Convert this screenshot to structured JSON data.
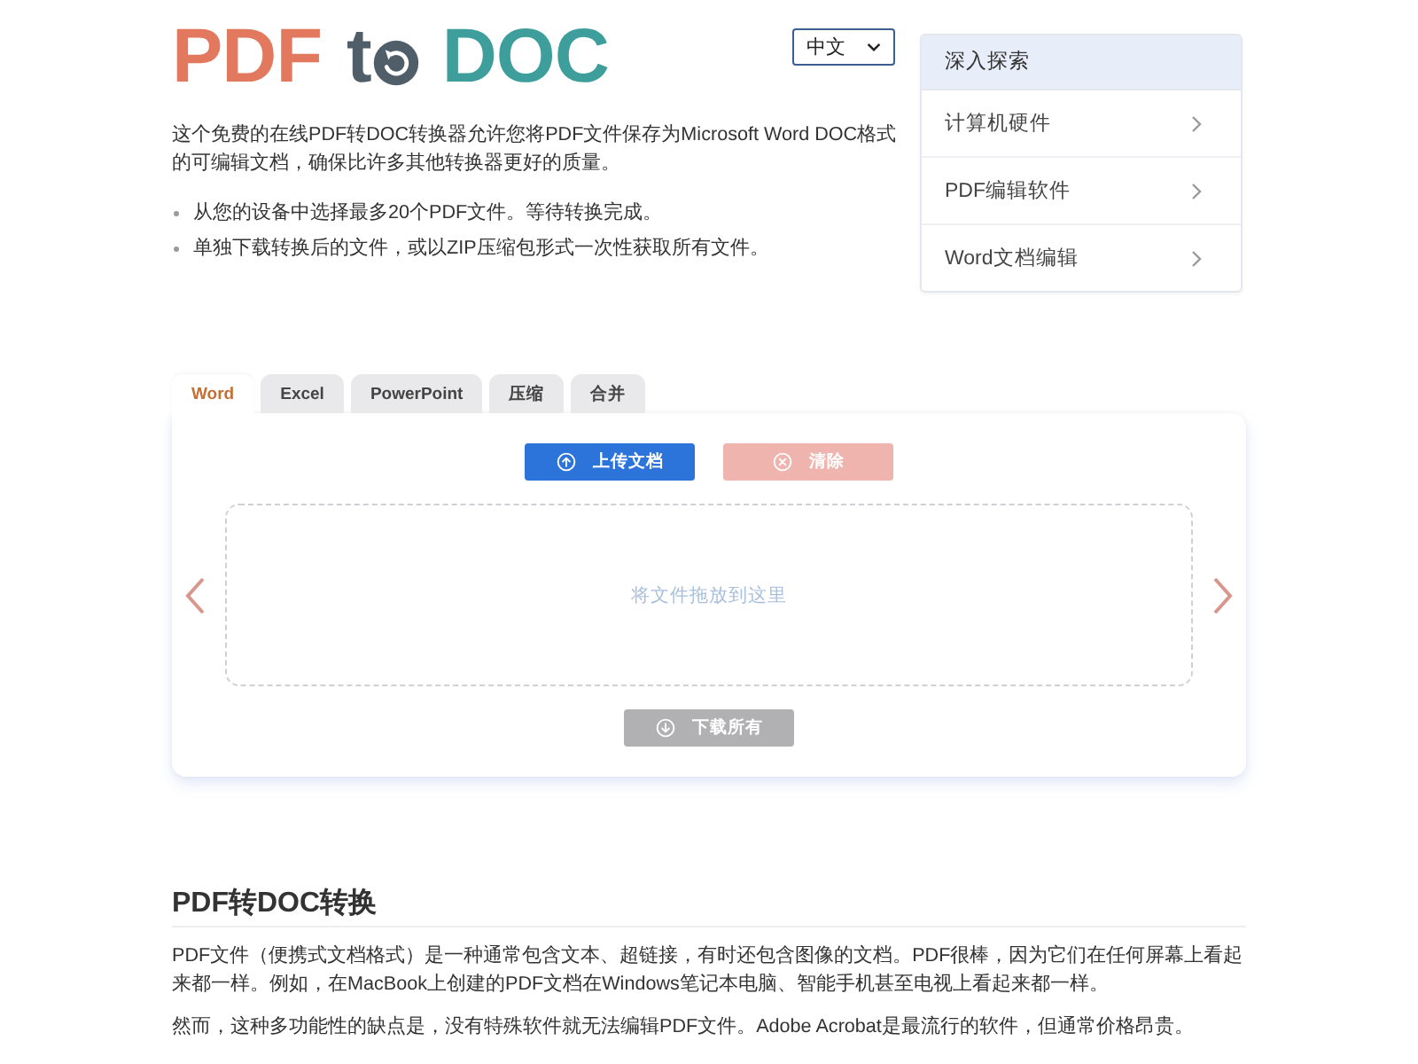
{
  "header": {
    "logo": {
      "before": "PDF",
      "middle": "t",
      "after": "DOC"
    },
    "language_select": {
      "value": "中文"
    }
  },
  "intro": {
    "text": "这个免费的在线PDF转DOC转换器允许您将PDF文件保存为Microsoft Word DOC格式的可编辑文档，确保比许多其他转换器更好的质量。",
    "bullets": [
      "从您的设备中选择最多20个PDF文件。等待转换完成。",
      "单独下载转换后的文件，或以ZIP压缩包形式一次性获取所有文件。"
    ]
  },
  "sidebar": {
    "title": "深入探索",
    "items": [
      {
        "label": "计算机硬件"
      },
      {
        "label": "PDF编辑软件"
      },
      {
        "label": "Word文档编辑"
      }
    ]
  },
  "converter": {
    "tabs": [
      {
        "label": "Word",
        "selected": true
      },
      {
        "label": "Excel",
        "selected": false
      },
      {
        "label": "PowerPoint",
        "selected": false
      },
      {
        "label": "压缩",
        "selected": false
      },
      {
        "label": "合并",
        "selected": false
      }
    ],
    "buttons": [
      {
        "kind": "upload",
        "label": "上传文档",
        "disabled": false
      },
      {
        "kind": "clear",
        "label": "清除",
        "disabled": true
      }
    ],
    "drop_zone": {
      "label": "将文件拖放到这里"
    },
    "download_button": {
      "label": "下载所有",
      "disabled": true
    }
  },
  "article": {
    "heading": "PDF转DOC转换",
    "paragraphs": [
      "PDF文件（便携式文档格式）是一种通常包含文本、超链接，有时还包含图像的文档。PDF很棒，因为它们在任何屏幕上看起来都一样。例如，在MacBook上创建的PDF文档在Windows笔记本电脑、智能手机甚至电视上看起来都一样。",
      "然而，这种多功能性的缺点是，没有特殊软件就无法编辑PDF文件。Adobe Acrobat是最流行的软件，但通常价格昂贵。"
    ]
  }
}
